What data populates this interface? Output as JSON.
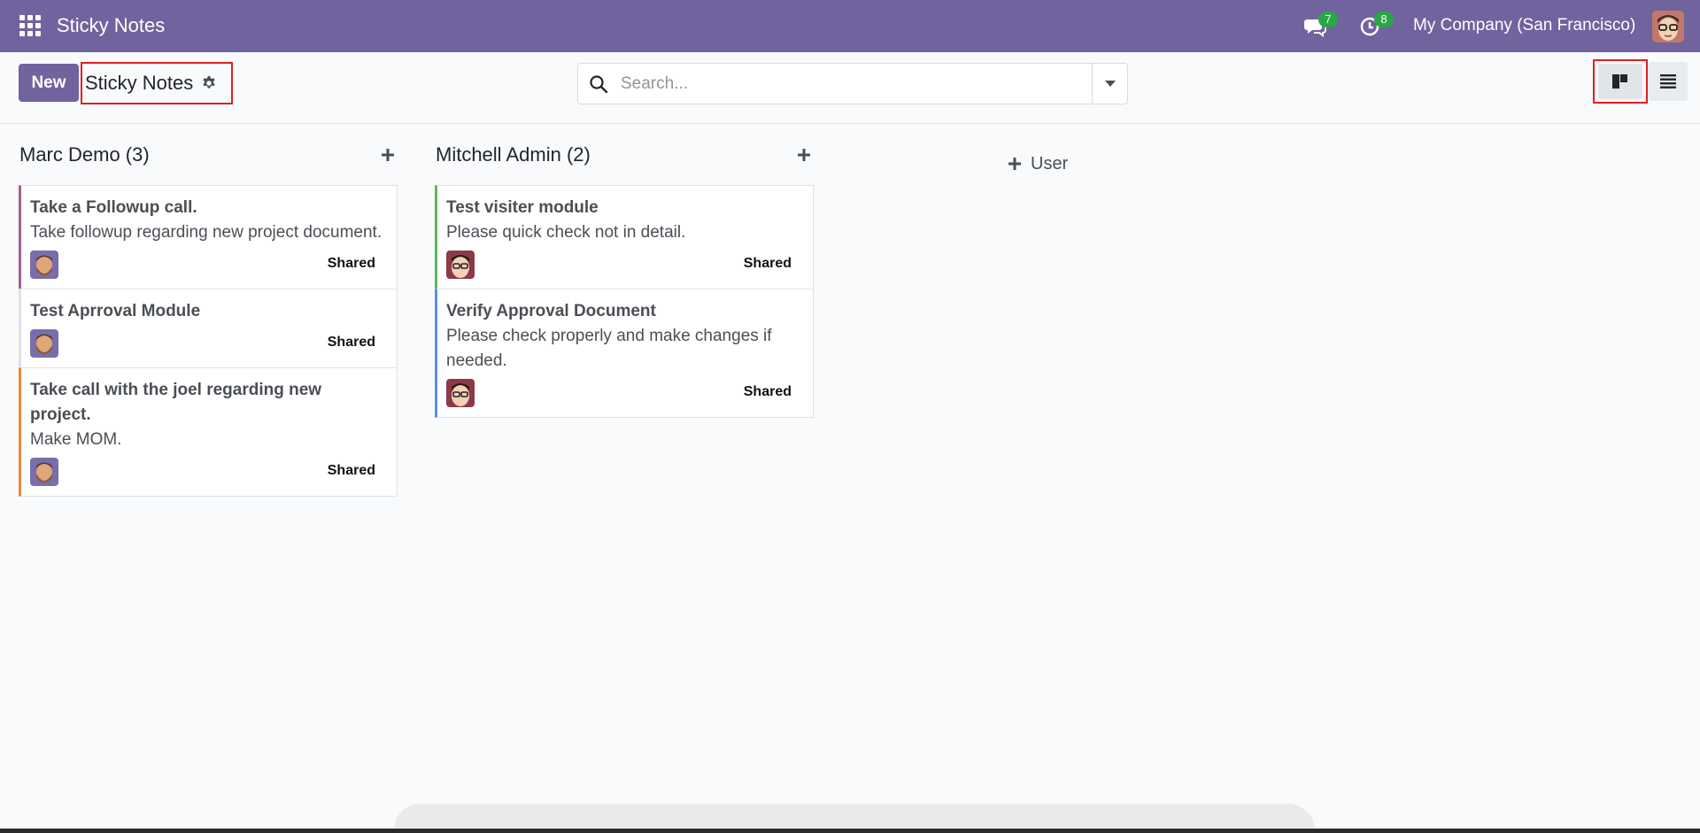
{
  "navbar": {
    "app_title": "Sticky Notes",
    "messages_count": "7",
    "activities_count": "8",
    "company": "My Company (San Francisco)",
    "bg_color": "#71639e"
  },
  "control_panel": {
    "new_label": "New",
    "breadcrumb": "Sticky Notes",
    "search_placeholder": "Search..."
  },
  "columns": [
    {
      "title": "Marc Demo (3)",
      "cards": [
        {
          "title": "Take a Followup call.",
          "desc": "Take followup regarding new project document.",
          "badge": "Shared",
          "color": "#a45f94"
        },
        {
          "title": "Test Aprroval Module",
          "desc": "",
          "badge": "Shared",
          "color": "#ffffff"
        },
        {
          "title": "Take call with the joel regarding new project.",
          "desc": "Make MOM.",
          "badge": "Shared",
          "color": "#e48a3a"
        }
      ]
    },
    {
      "title": "Mitchell Admin (2)",
      "cards": [
        {
          "title": "Test visiter module",
          "desc": "Please quick check not in detail.",
          "badge": "Shared",
          "color": "#5cb85c"
        },
        {
          "title": "Verify Approval Document",
          "desc": "Please check properly and make changes if needed.",
          "badge": "Shared",
          "color": "#5a8ee0"
        }
      ]
    }
  ],
  "add_column_label": "User"
}
